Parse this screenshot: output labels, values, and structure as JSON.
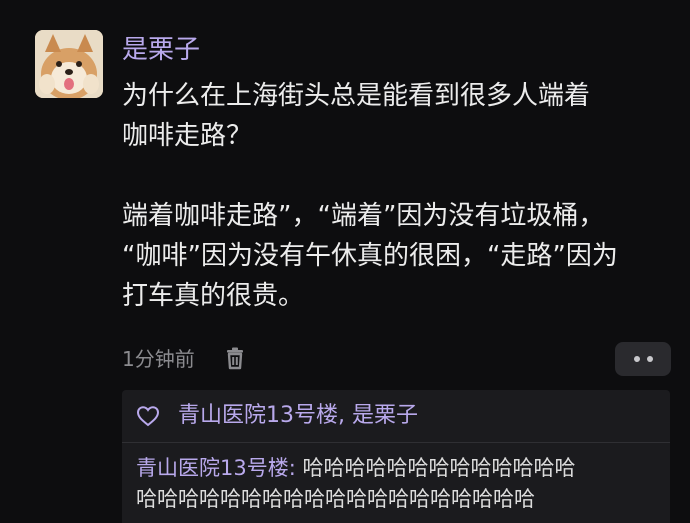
{
  "post": {
    "author": "是栗子",
    "body_lines": [
      "为什么在上海街头总是能看到很多人端着",
      "咖啡走路？",
      "",
      "端着咖啡走路”，“端着”因为没有垃圾桶，",
      "“咖啡”因为没有午休真的很困，“走路”因为",
      "打车真的很贵。"
    ],
    "time": "1分钟前"
  },
  "likes": {
    "names": "青山医院13号楼, 是栗子"
  },
  "reply": {
    "author": "青山医院13号楼:",
    "line1_text": " 哈哈哈哈哈哈哈哈哈哈哈哈哈",
    "line2_text": "哈哈哈哈哈哈哈哈哈哈哈哈哈哈哈哈哈哈哈"
  },
  "colors": {
    "background": "#0d0d0f",
    "name_accent": "#b9a9ec",
    "panel": "#1b1b1e",
    "meta": "#8b8b8f"
  },
  "icons": [
    "avatar-shiba-dog",
    "trash-icon",
    "more-icon",
    "heart-icon"
  ]
}
